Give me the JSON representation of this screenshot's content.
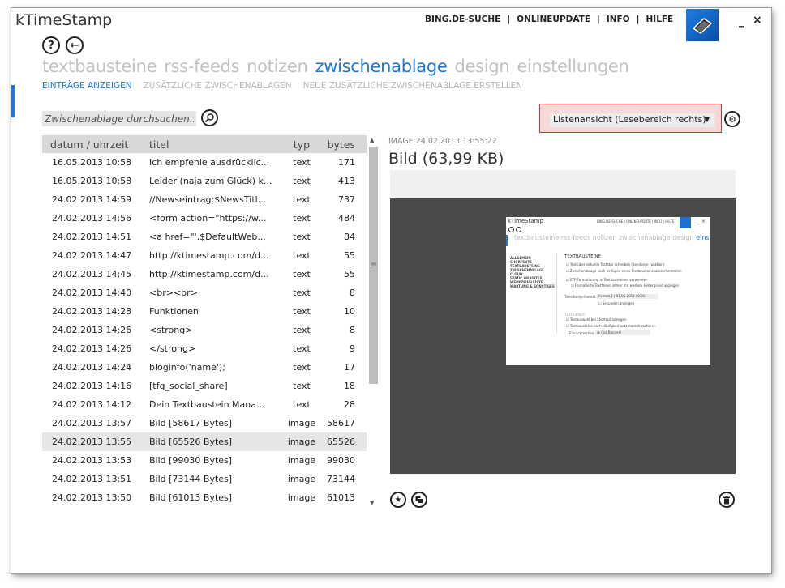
{
  "app": {
    "title": "kTimeStamp"
  },
  "topnav": [
    "BING.DE-SUCHE",
    "ONLINEUPDATE",
    "INFO",
    "HILFE"
  ],
  "window_controls": {
    "minimize": "_",
    "close": "×"
  },
  "help_button": "?",
  "back_button": "←",
  "main_tabs": [
    "textbausteine",
    "rss-feeds",
    "notizen",
    "zwischenablage",
    "design",
    "einstellungen"
  ],
  "active_main_tab": "zwischenablage",
  "sub_tabs": [
    "EINTRÄGE ANZEIGEN",
    "ZUSÄTZLICHE ZWISCHENABLAGEN",
    "NEUE ZUSÄTZLICHE ZWISCHENABLAGE ERSTELLEN"
  ],
  "search": {
    "placeholder": "Zwischenablage durchsuchen..."
  },
  "view_select": {
    "value": "Listenansicht (Lesebereich rechts)"
  },
  "table": {
    "headers": [
      "datum / uhrzeit",
      "titel",
      "typ",
      "bytes"
    ],
    "rows": [
      [
        "16.05.2013 10:58",
        "Ich empfehle ausdrücklic...",
        "text",
        "171"
      ],
      [
        "16.05.2013 10:58",
        "Leider (naja zum Glück) k...",
        "text",
        "413"
      ],
      [
        "24.02.2013 14:59",
        "//Newseintrag:$NewsTitl...",
        "text",
        "737"
      ],
      [
        "24.02.2013 14:56",
        "<form action=\"https://w...",
        "text",
        "484"
      ],
      [
        "24.02.2013 14:51",
        "<a href=\"'.$DefaultWeb...",
        "text",
        "84"
      ],
      [
        "24.02.2013 14:47",
        "http://ktimestamp.com/d...",
        "text",
        "55"
      ],
      [
        "24.02.2013 14:45",
        "http://ktimestamp.com/d...",
        "text",
        "55"
      ],
      [
        "24.02.2013 14:40",
        "<br><br>",
        "text",
        "8"
      ],
      [
        "24.02.2013 14:28",
        "Funktionen",
        "text",
        "10"
      ],
      [
        "24.02.2013 14:26",
        "<strong>",
        "text",
        "8"
      ],
      [
        "24.02.2013 14:26",
        "</strong>",
        "text",
        "9"
      ],
      [
        "24.02.2013 14:24",
        "bloginfo('name');",
        "text",
        "17"
      ],
      [
        "24.02.2013 14:16",
        "[tfg_social_share]",
        "text",
        "18"
      ],
      [
        "24.02.2013 14:12",
        "Dein Textbaustein Mana...",
        "text",
        "28"
      ],
      [
        "24.02.2013 13:57",
        "Bild [58617 Bytes]",
        "image",
        "58617"
      ],
      [
        "24.02.2013 13:55",
        "Bild [65526 Bytes]",
        "image",
        "65526"
      ],
      [
        "24.02.2013 13:53",
        "Bild [99030 Bytes]",
        "image",
        "99030"
      ],
      [
        "24.02.2013 13:51",
        "Bild [73144 Bytes]",
        "image",
        "73144"
      ],
      [
        "24.02.2013 13:50",
        "Bild [61013 Bytes]",
        "image",
        "61013"
      ]
    ],
    "selected_index": 15
  },
  "preview": {
    "meta": "IMAGE 24.02.2013 13:55:22",
    "title": "Bild (63,99 KB)",
    "thumbnail": {
      "title": "kTimeStamp",
      "topnav": "BING.DE-SUCHE | ONLINEUPDATE | INFO | HILFE",
      "tabs": "textbausteine rss-feeds notizen zwischenablage design",
      "active_tab": "einstellungen",
      "sidebar": [
        "ALLGEMEIN",
        "SHORTCUTS",
        "TEXTBAUSTEINE",
        "ZWISCHENABLAGE",
        "CLOUD",
        "STATIC WEBSITES",
        "WERKZEUGLEISTE",
        "WARTUNG & SONSTIGES"
      ],
      "section": "TEXTBAUSTEINE",
      "options": [
        "Text über virtuelle Tastatur schreiben (Sendkeys-Funktion)",
        "Zwischenablage nach einfügen eines Textbausteins wiederherstellen",
        "RTF-Formatierung in Textbausteinen verwenden",
        "Formatierte Textfelder immer mit weißem Hintergrund anzeigen"
      ],
      "timestamp_label": "TimeStamp-Format:",
      "timestamp_value": "Format 1 | 01.01.2011 00:00",
      "seconds_label": "Sekunden anzeigen",
      "section2": "TEXTEXPERT",
      "options2": [
        "Textauswahl bei Shortcut anzeigen",
        "Textbausteine nach Häufigkeit automatisch sortieren"
      ],
      "delimiter_label": "Einrückzeichen:",
      "delimiter_value": "@ (bis Banner)"
    }
  },
  "icons": {
    "search": "search-icon",
    "gear": "gear-icon",
    "star": "star-icon",
    "copy": "copy-icon",
    "trash": "trash-icon"
  }
}
